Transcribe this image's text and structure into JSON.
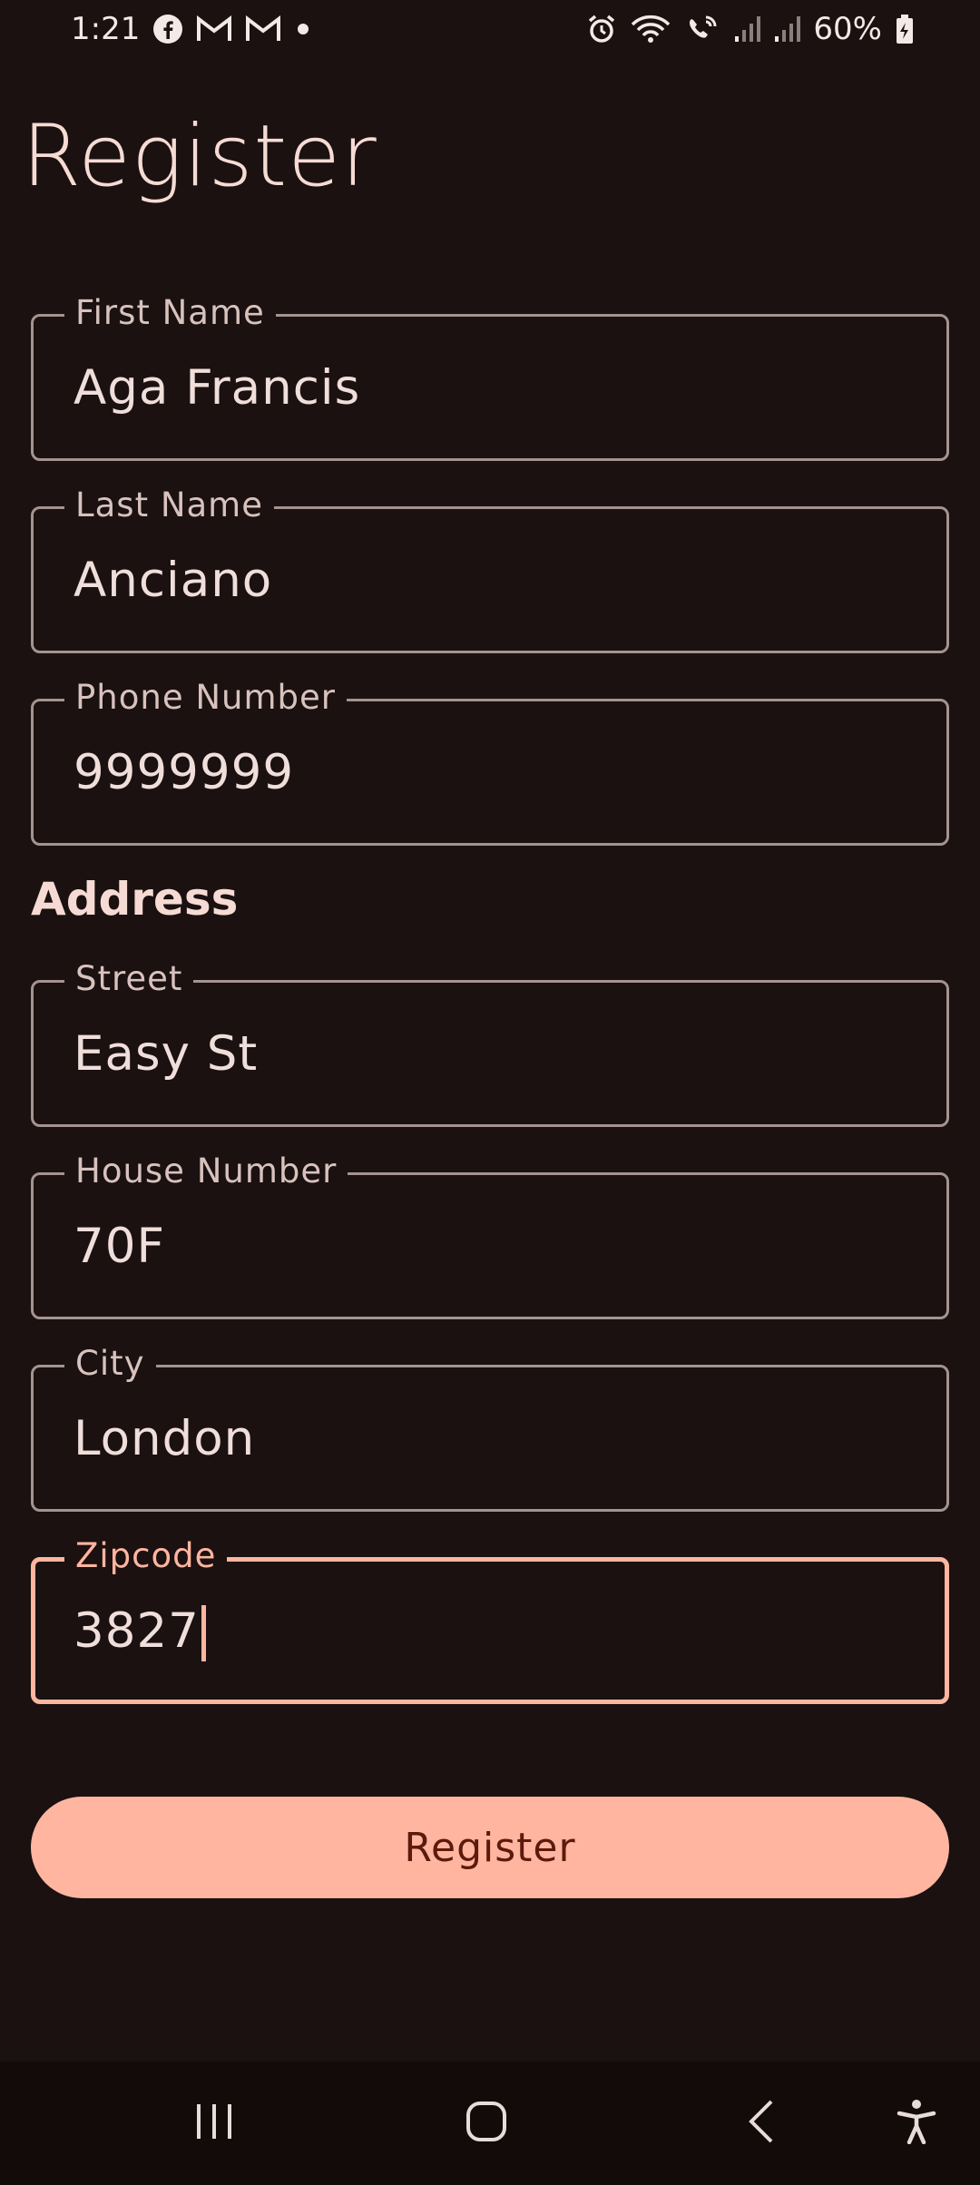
{
  "status_bar": {
    "time": "1:21",
    "battery": "60%",
    "icons": [
      "facebook-icon",
      "gmail-icon",
      "gmail-icon",
      "dot-icon",
      "alarm-icon",
      "wifi-icon",
      "wifi-calling-icon",
      "signal-icon",
      "signal-icon",
      "battery-charging-icon"
    ]
  },
  "page": {
    "title": "Register"
  },
  "fields": {
    "first_name": {
      "label": "First Name",
      "value": "Aga Francis"
    },
    "last_name": {
      "label": "Last Name",
      "value": "Anciano"
    },
    "phone": {
      "label": "Phone Number",
      "value": "9999999"
    },
    "street": {
      "label": "Street",
      "value": "Easy St"
    },
    "house_number": {
      "label": "House Number",
      "value": "70F"
    },
    "city": {
      "label": "City",
      "value": "London"
    },
    "zipcode": {
      "label": "Zipcode",
      "value": "3827"
    }
  },
  "address_heading": "Address",
  "register_button": {
    "label": "Register"
  },
  "colors": {
    "background": "#1a1110",
    "accent": "#ffb5a0",
    "outline": "#a59390",
    "button_text": "#5c1a0c"
  },
  "nav_bar": {
    "icons": [
      "recent-apps-icon",
      "home-icon",
      "back-icon",
      "accessibility-icon"
    ]
  }
}
